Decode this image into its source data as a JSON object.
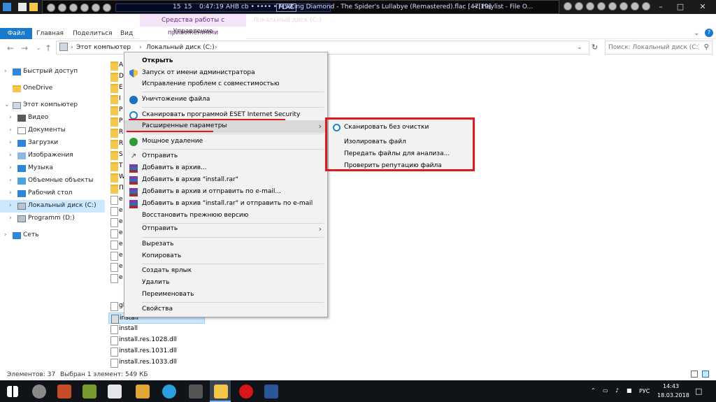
{
  "player": {
    "num_a": "15",
    "num_b": "15",
    "time": "0:47:19",
    "codec": "AHB cb • •••• • MSC",
    "format": "FLAC",
    "track": "King Diamond - The Spider's Lullabye (Remastered).flac  [47:19]",
    "playlist": "<[Playlist - File O..."
  },
  "ribbon": {
    "tabs": [
      "Файл",
      "Главная",
      "Поделиться",
      "Вид"
    ],
    "context_group": "Средства работы с приложениями",
    "context_tab": "Управление",
    "window_title": "Локальный диск (C:)"
  },
  "address": {
    "crumbs": [
      "Этот компьютер",
      "Локальный диск (C:)"
    ],
    "search_placeholder": "Поиск: Локальный диск (C:)"
  },
  "nav": [
    {
      "label": "Быстрый доступ",
      "icon": "star-icon"
    },
    {
      "label": "OneDrive",
      "icon": "folder-icon"
    },
    {
      "label": "Этот компьютер",
      "icon": "computer-icon"
    },
    {
      "label": "Видео",
      "icon": "video-icon"
    },
    {
      "label": "Документы",
      "icon": "documents-icon"
    },
    {
      "label": "Загрузки",
      "icon": "download-icon"
    },
    {
      "label": "Изображения",
      "icon": "pictures-icon"
    },
    {
      "label": "Музыка",
      "icon": "music-icon"
    },
    {
      "label": "Объемные объекты",
      "icon": "3d-objects-icon"
    },
    {
      "label": "Рабочий стол",
      "icon": "desktop-icon"
    },
    {
      "label": "Локальный диск (C:)",
      "icon": "drive-icon"
    },
    {
      "label": "Programm (D:)",
      "icon": "drive-icon"
    },
    {
      "label": "Сеть",
      "icon": "network-icon"
    }
  ],
  "files": [
    "A",
    "D",
    "E",
    "I",
    "P",
    "P",
    "R",
    "R",
    "S",
    "T",
    "W",
    "П",
    "e",
    "e",
    "e",
    "e",
    "e",
    "e",
    "e",
    "e",
    "gl",
    "install",
    "install",
    "install.res.1028.dll",
    "install.res.1031.dll",
    "install.res.1033.dll"
  ],
  "menu": {
    "items": [
      {
        "label": "Открыть",
        "bold": true
      },
      {
        "label": "Запуск от имени администратора",
        "icon": "shield-icon"
      },
      {
        "label": "Исправление проблем с совместимостью"
      },
      {
        "label": "Уничтожение файла",
        "icon": "shredder-icon"
      },
      {
        "label": "Сканировать программой ESET Internet Security",
        "icon": "eset-icon"
      },
      {
        "label": "Расширенные параметры"
      },
      {
        "label": "Мощное удаление",
        "icon": "uninstall-icon"
      },
      {
        "label": "Отправить",
        "icon": "share-icon"
      },
      {
        "label": "Добавить в архив...",
        "icon": "winrar-icon"
      },
      {
        "label": "Добавить в архив \"install.rar\"",
        "icon": "winrar-icon"
      },
      {
        "label": "Добавить в архив и отправить по e-mail...",
        "icon": "winrar-icon"
      },
      {
        "label": "Добавить в архив \"install.rar\" и отправить по e-mail",
        "icon": "winrar-icon"
      },
      {
        "label": "Восстановить прежнюю версию"
      },
      {
        "label": "Отправить"
      },
      {
        "label": "Вырезать"
      },
      {
        "label": "Копировать"
      },
      {
        "label": "Создать ярлык"
      },
      {
        "label": "Удалить"
      },
      {
        "label": "Переименовать"
      },
      {
        "label": "Свойства"
      }
    ]
  },
  "submenu": {
    "items": [
      {
        "label": "Сканировать без очистки",
        "icon": "eset-icon"
      },
      {
        "label": "Изолировать файл"
      },
      {
        "label": "Передать файлы для анализа..."
      },
      {
        "label": "Проверить репутацию файла"
      }
    ]
  },
  "status": {
    "count": "Элементов: 37",
    "selected": "Выбран 1 элемент: 549 КБ"
  },
  "taskbar": {
    "lang": "РУС",
    "time": "14:43",
    "date": "18.03.2018"
  },
  "colors": {
    "accent": "#1979ca",
    "highlight_red": "#e0191f",
    "selection": "#cce8ff"
  }
}
